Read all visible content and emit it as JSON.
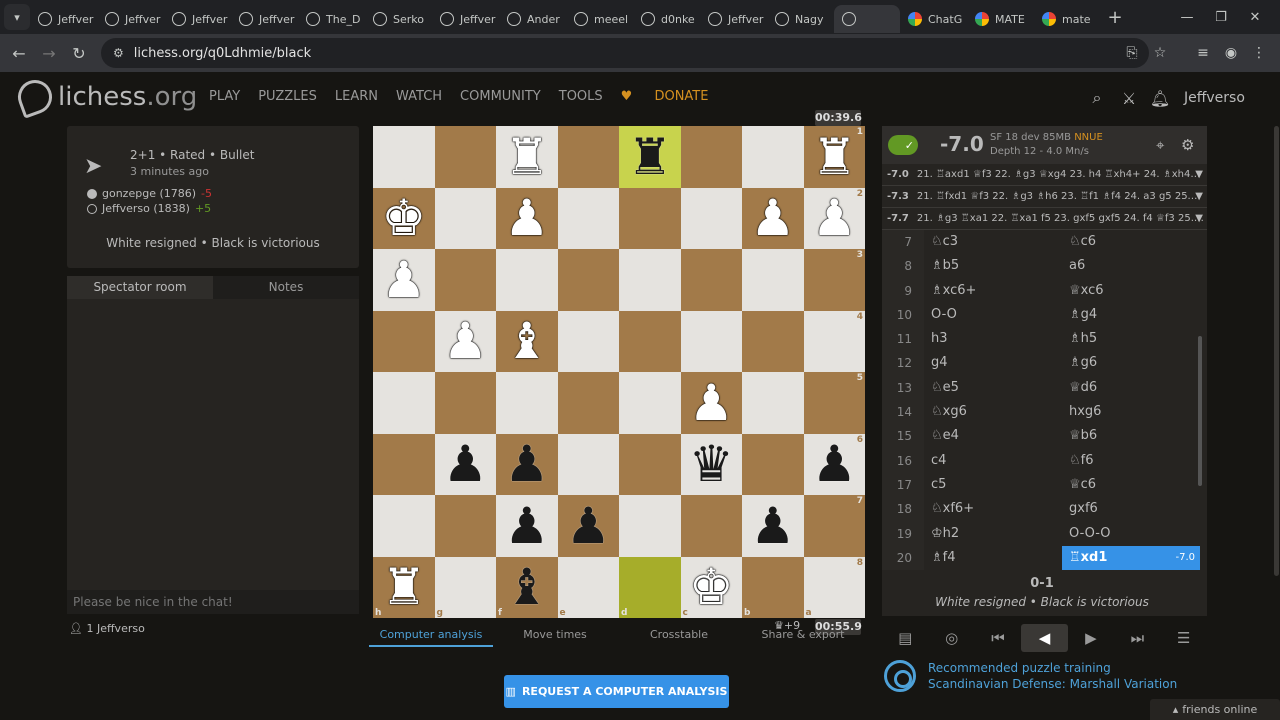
{
  "browser": {
    "tabs": [
      "Jeffver",
      "Jeffver",
      "Jeffver",
      "Jeffver",
      "The_D",
      "Serko",
      "Jeffver",
      "Ander",
      "meeel",
      "d0nke",
      "Jeffver",
      "Nagy",
      "",
      "ChatG",
      "MATE",
      "mate"
    ],
    "active_tab_index": 12,
    "url": "lichess.org/q0Ldhmie/black"
  },
  "header": {
    "logo": "lichess",
    "logo_suffix": ".org",
    "nav": [
      "PLAY",
      "PUZZLES",
      "LEARN",
      "WATCH",
      "COMMUNITY",
      "TOOLS",
      "DONATE"
    ],
    "username": "Jeffverso"
  },
  "game_info": {
    "setup": "2+1 • Rated • Bullet",
    "time_ago": "3 minutes ago",
    "white_player": "gonzepge (1786)",
    "white_diff": "-5",
    "black_player": "Jeffverso (1838)",
    "black_diff": "+5",
    "result": "White resigned • Black is victorious"
  },
  "chat": {
    "tabs": [
      "Spectator room",
      "Notes"
    ],
    "placeholder": "Please be nice in the chat!",
    "spectators": "1 Jeffverso"
  },
  "board": {
    "files_bottom": [
      "h",
      "g",
      "f",
      "e",
      "d",
      "c",
      "b",
      "a"
    ],
    "ranks_right": [
      "1",
      "2",
      "3",
      "4",
      "5",
      "6",
      "7",
      "8"
    ],
    "top_clock": "00:39.6",
    "bottom_clock": "00:55.9",
    "material": "+9"
  },
  "under_board_tabs": [
    "Computer analysis",
    "Move times",
    "Crosstable",
    "Share & export"
  ],
  "request_button": "REQUEST A COMPUTER ANALYSIS",
  "ceval": {
    "score": "-7.0",
    "engine": "SF 18 dev 85MB",
    "nnue": "NNUE",
    "depth": "Depth 12 - 4.0 Mn/s",
    "lines": [
      {
        "eval": "-7.0",
        "moves": "21. ♖axd1 ♕f3 22. ♗g3 ♕xg4 23. h4 ♖xh4+ 24. ♗xh4…"
      },
      {
        "eval": "-7.3",
        "moves": "21. ♖fxd1 ♕f3 22. ♗g3 ♗h6 23. ♖f1 ♗f4 24. a3 g5 25.…"
      },
      {
        "eval": "-7.7",
        "moves": "21. ♗g3 ♖xa1 22. ♖xa1 f5 23. gxf5 gxf5 24. f4 ♕f3 25.…"
      }
    ]
  },
  "moves": [
    {
      "n": "7",
      "w": "♘c3",
      "b": "♘c6"
    },
    {
      "n": "8",
      "w": "♗b5",
      "b": "a6"
    },
    {
      "n": "9",
      "w": "♗xc6+",
      "b": "♕xc6"
    },
    {
      "n": "10",
      "w": "O-O",
      "b": "♗g4"
    },
    {
      "n": "11",
      "w": "h3",
      "b": "♗h5"
    },
    {
      "n": "12",
      "w": "g4",
      "b": "♗g6"
    },
    {
      "n": "13",
      "w": "♘e5",
      "b": "♕d6"
    },
    {
      "n": "14",
      "w": "♘xg6",
      "b": "hxg6"
    },
    {
      "n": "15",
      "w": "♘e4",
      "b": "♕b6"
    },
    {
      "n": "16",
      "w": "c4",
      "b": "♘f6"
    },
    {
      "n": "17",
      "w": "c5",
      "b": "♕c6"
    },
    {
      "n": "18",
      "w": "♘xf6+",
      "b": "gxf6"
    },
    {
      "n": "19",
      "w": "♔h2",
      "b": "O-O-O"
    },
    {
      "n": "20",
      "w": "♗f4",
      "b": "♖xd1",
      "b_eval": "-7.0"
    }
  ],
  "result": {
    "score": "0-1",
    "text": "White resigned • Black is victorious"
  },
  "puzzle": {
    "line1": "Recommended puzzle training",
    "line2": "Scandinavian Defense: Marshall Variation"
  },
  "friends": "friends online",
  "colors": {
    "accent": "#3692e7",
    "board_light": "#e5e3df",
    "board_dark": "#a27a49",
    "highlight": "#c8d34d",
    "engine_on": "#629924",
    "donate": "#d59120"
  }
}
